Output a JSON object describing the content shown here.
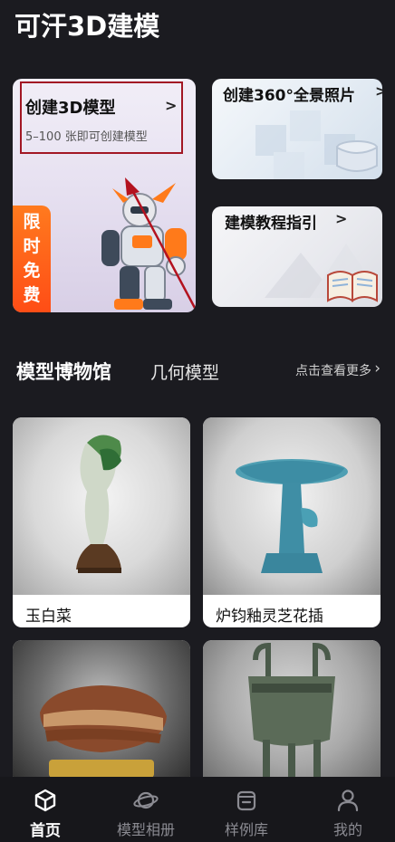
{
  "app": {
    "title": "可汗3D建模"
  },
  "cards": {
    "create3d": {
      "title": "创建3D模型",
      "arrow": ">",
      "subtitle": "5–100 张即可创建模型",
      "badge": [
        "限",
        "时",
        "免",
        "费"
      ]
    },
    "panorama": {
      "title": "创建360°全景照片",
      "arrow": ">"
    },
    "tutorial": {
      "title": "建模教程指引",
      "arrow": ">"
    }
  },
  "museum": {
    "title": "模型博物馆",
    "tab": "几何模型",
    "more": "点击查看更多",
    "items": [
      {
        "caption": "玉白菜"
      },
      {
        "caption": "炉钧釉灵芝花插"
      },
      {
        "caption": ""
      },
      {
        "caption": ""
      }
    ]
  },
  "nav": {
    "items": [
      {
        "label": "首页",
        "icon": "cube-icon",
        "active": true
      },
      {
        "label": "模型相册",
        "icon": "planet-icon",
        "active": false
      },
      {
        "label": "样例库",
        "icon": "box-icon",
        "active": false
      },
      {
        "label": "我的",
        "icon": "user-icon",
        "active": false
      }
    ]
  },
  "colors": {
    "background": "#1b1b20",
    "highlight_box": "#a21724",
    "badge": "#ff5a18"
  }
}
